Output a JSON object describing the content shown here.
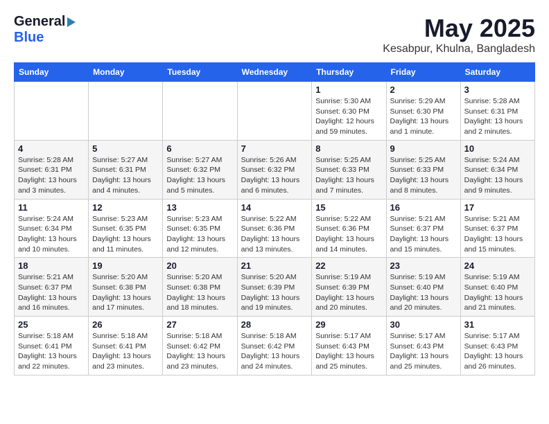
{
  "logo": {
    "general": "General",
    "blue": "Blue"
  },
  "title": "May 2025",
  "subtitle": "Kesabpur, Khulna, Bangladesh",
  "days_of_week": [
    "Sunday",
    "Monday",
    "Tuesday",
    "Wednesday",
    "Thursday",
    "Friday",
    "Saturday"
  ],
  "weeks": [
    [
      {
        "day": "",
        "sunrise": "",
        "sunset": "",
        "daylight": ""
      },
      {
        "day": "",
        "sunrise": "",
        "sunset": "",
        "daylight": ""
      },
      {
        "day": "",
        "sunrise": "",
        "sunset": "",
        "daylight": ""
      },
      {
        "day": "",
        "sunrise": "",
        "sunset": "",
        "daylight": ""
      },
      {
        "day": "1",
        "sunrise": "5:30 AM",
        "sunset": "6:30 PM",
        "daylight": "12 hours and 59 minutes."
      },
      {
        "day": "2",
        "sunrise": "5:29 AM",
        "sunset": "6:30 PM",
        "daylight": "13 hours and 1 minute."
      },
      {
        "day": "3",
        "sunrise": "5:28 AM",
        "sunset": "6:31 PM",
        "daylight": "13 hours and 2 minutes."
      }
    ],
    [
      {
        "day": "4",
        "sunrise": "5:28 AM",
        "sunset": "6:31 PM",
        "daylight": "13 hours and 3 minutes."
      },
      {
        "day": "5",
        "sunrise": "5:27 AM",
        "sunset": "6:31 PM",
        "daylight": "13 hours and 4 minutes."
      },
      {
        "day": "6",
        "sunrise": "5:27 AM",
        "sunset": "6:32 PM",
        "daylight": "13 hours and 5 minutes."
      },
      {
        "day": "7",
        "sunrise": "5:26 AM",
        "sunset": "6:32 PM",
        "daylight": "13 hours and 6 minutes."
      },
      {
        "day": "8",
        "sunrise": "5:25 AM",
        "sunset": "6:33 PM",
        "daylight": "13 hours and 7 minutes."
      },
      {
        "day": "9",
        "sunrise": "5:25 AM",
        "sunset": "6:33 PM",
        "daylight": "13 hours and 8 minutes."
      },
      {
        "day": "10",
        "sunrise": "5:24 AM",
        "sunset": "6:34 PM",
        "daylight": "13 hours and 9 minutes."
      }
    ],
    [
      {
        "day": "11",
        "sunrise": "5:24 AM",
        "sunset": "6:34 PM",
        "daylight": "13 hours and 10 minutes."
      },
      {
        "day": "12",
        "sunrise": "5:23 AM",
        "sunset": "6:35 PM",
        "daylight": "13 hours and 11 minutes."
      },
      {
        "day": "13",
        "sunrise": "5:23 AM",
        "sunset": "6:35 PM",
        "daylight": "13 hours and 12 minutes."
      },
      {
        "day": "14",
        "sunrise": "5:22 AM",
        "sunset": "6:36 PM",
        "daylight": "13 hours and 13 minutes."
      },
      {
        "day": "15",
        "sunrise": "5:22 AM",
        "sunset": "6:36 PM",
        "daylight": "13 hours and 14 minutes."
      },
      {
        "day": "16",
        "sunrise": "5:21 AM",
        "sunset": "6:37 PM",
        "daylight": "13 hours and 15 minutes."
      },
      {
        "day": "17",
        "sunrise": "5:21 AM",
        "sunset": "6:37 PM",
        "daylight": "13 hours and 15 minutes."
      }
    ],
    [
      {
        "day": "18",
        "sunrise": "5:21 AM",
        "sunset": "6:37 PM",
        "daylight": "13 hours and 16 minutes."
      },
      {
        "day": "19",
        "sunrise": "5:20 AM",
        "sunset": "6:38 PM",
        "daylight": "13 hours and 17 minutes."
      },
      {
        "day": "20",
        "sunrise": "5:20 AM",
        "sunset": "6:38 PM",
        "daylight": "13 hours and 18 minutes."
      },
      {
        "day": "21",
        "sunrise": "5:20 AM",
        "sunset": "6:39 PM",
        "daylight": "13 hours and 19 minutes."
      },
      {
        "day": "22",
        "sunrise": "5:19 AM",
        "sunset": "6:39 PM",
        "daylight": "13 hours and 20 minutes."
      },
      {
        "day": "23",
        "sunrise": "5:19 AM",
        "sunset": "6:40 PM",
        "daylight": "13 hours and 20 minutes."
      },
      {
        "day": "24",
        "sunrise": "5:19 AM",
        "sunset": "6:40 PM",
        "daylight": "13 hours and 21 minutes."
      }
    ],
    [
      {
        "day": "25",
        "sunrise": "5:18 AM",
        "sunset": "6:41 PM",
        "daylight": "13 hours and 22 minutes."
      },
      {
        "day": "26",
        "sunrise": "5:18 AM",
        "sunset": "6:41 PM",
        "daylight": "13 hours and 23 minutes."
      },
      {
        "day": "27",
        "sunrise": "5:18 AM",
        "sunset": "6:42 PM",
        "daylight": "13 hours and 23 minutes."
      },
      {
        "day": "28",
        "sunrise": "5:18 AM",
        "sunset": "6:42 PM",
        "daylight": "13 hours and 24 minutes."
      },
      {
        "day": "29",
        "sunrise": "5:17 AM",
        "sunset": "6:43 PM",
        "daylight": "13 hours and 25 minutes."
      },
      {
        "day": "30",
        "sunrise": "5:17 AM",
        "sunset": "6:43 PM",
        "daylight": "13 hours and 25 minutes."
      },
      {
        "day": "31",
        "sunrise": "5:17 AM",
        "sunset": "6:43 PM",
        "daylight": "13 hours and 26 minutes."
      }
    ]
  ],
  "labels": {
    "sunrise": "Sunrise:",
    "sunset": "Sunset:",
    "daylight": "Daylight:"
  }
}
